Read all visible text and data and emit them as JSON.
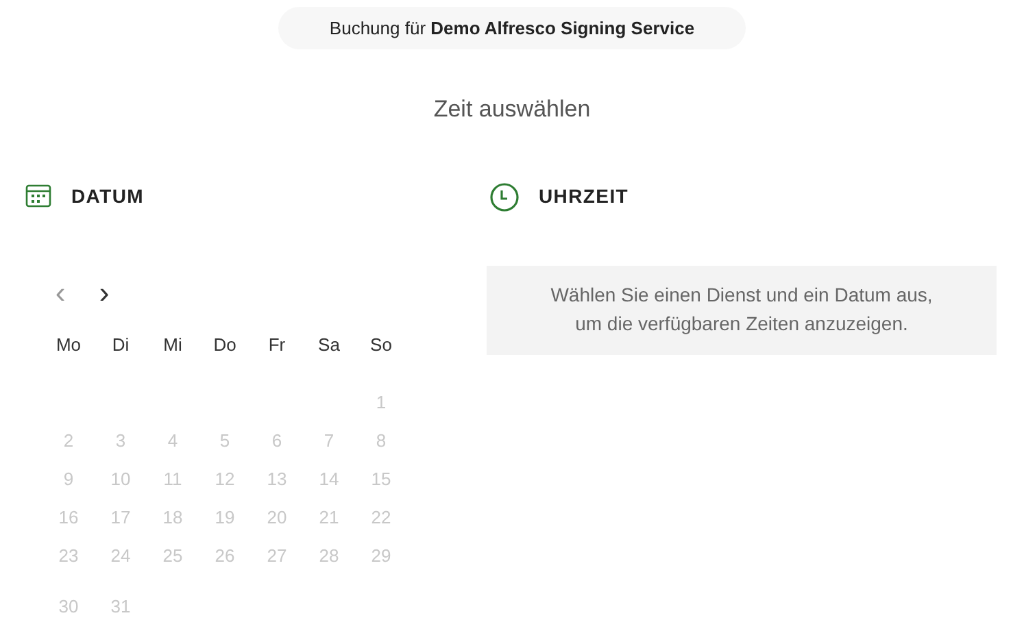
{
  "booking_banner": {
    "text": "Buchung für **Demo Alfresco Signing Service**"
  },
  "title": "Zeit auswählen",
  "date_section": {
    "heading": "DATUM",
    "nav": {
      "previous": "‹",
      "next": "›"
    },
    "weekdays": [
      "Mo",
      "Di",
      "Mi",
      "Do",
      "Fr",
      "Sa",
      "So"
    ],
    "weeks": [
      {
        "kind": "first",
        "days": [
          {
            "day": "1",
            "disabled": true
          }
        ]
      },
      {
        "kind": "regular",
        "days": [
          {
            "day": "2",
            "disabled": true
          },
          {
            "day": "3",
            "disabled": true
          },
          {
            "day": "4",
            "disabled": true
          },
          {
            "day": "5",
            "disabled": true
          },
          {
            "day": "6",
            "disabled": true
          },
          {
            "day": "7",
            "disabled": true
          },
          {
            "day": "8",
            "disabled": true
          }
        ]
      },
      {
        "kind": "regular",
        "days": [
          {
            "day": "9",
            "disabled": true
          },
          {
            "day": "10",
            "disabled": true
          },
          {
            "day": "11",
            "disabled": true
          },
          {
            "day": "12",
            "disabled": true
          },
          {
            "day": "13",
            "disabled": true
          },
          {
            "day": "14",
            "disabled": true
          },
          {
            "day": "15",
            "disabled": true
          }
        ]
      },
      {
        "kind": "regular",
        "days": [
          {
            "day": "16",
            "disabled": true
          },
          {
            "day": "17",
            "disabled": true
          },
          {
            "day": "18",
            "disabled": true
          },
          {
            "day": "19",
            "disabled": true
          },
          {
            "day": "20",
            "disabled": true
          },
          {
            "day": "21",
            "disabled": true
          },
          {
            "day": "22",
            "disabled": true
          }
        ]
      },
      {
        "kind": "regular",
        "days": [
          {
            "day": "23",
            "disabled": true
          },
          {
            "day": "24",
            "disabled": true
          },
          {
            "day": "25",
            "disabled": true
          },
          {
            "day": "26",
            "disabled": true
          },
          {
            "day": "27",
            "disabled": true
          },
          {
            "day": "28",
            "disabled": true
          },
          {
            "day": "29",
            "disabled": true
          }
        ]
      },
      {
        "kind": "regular",
        "days": [
          {
            "day": "30",
            "disabled": true
          },
          {
            "day": "31",
            "disabled": true
          }
        ]
      }
    ]
  },
  "time_section": {
    "heading": "UHRZEIT",
    "message": "Wählen Sie einen Dienst und ein Datum aus, um die verfügbaren Zeiten anzuzeigen."
  }
}
